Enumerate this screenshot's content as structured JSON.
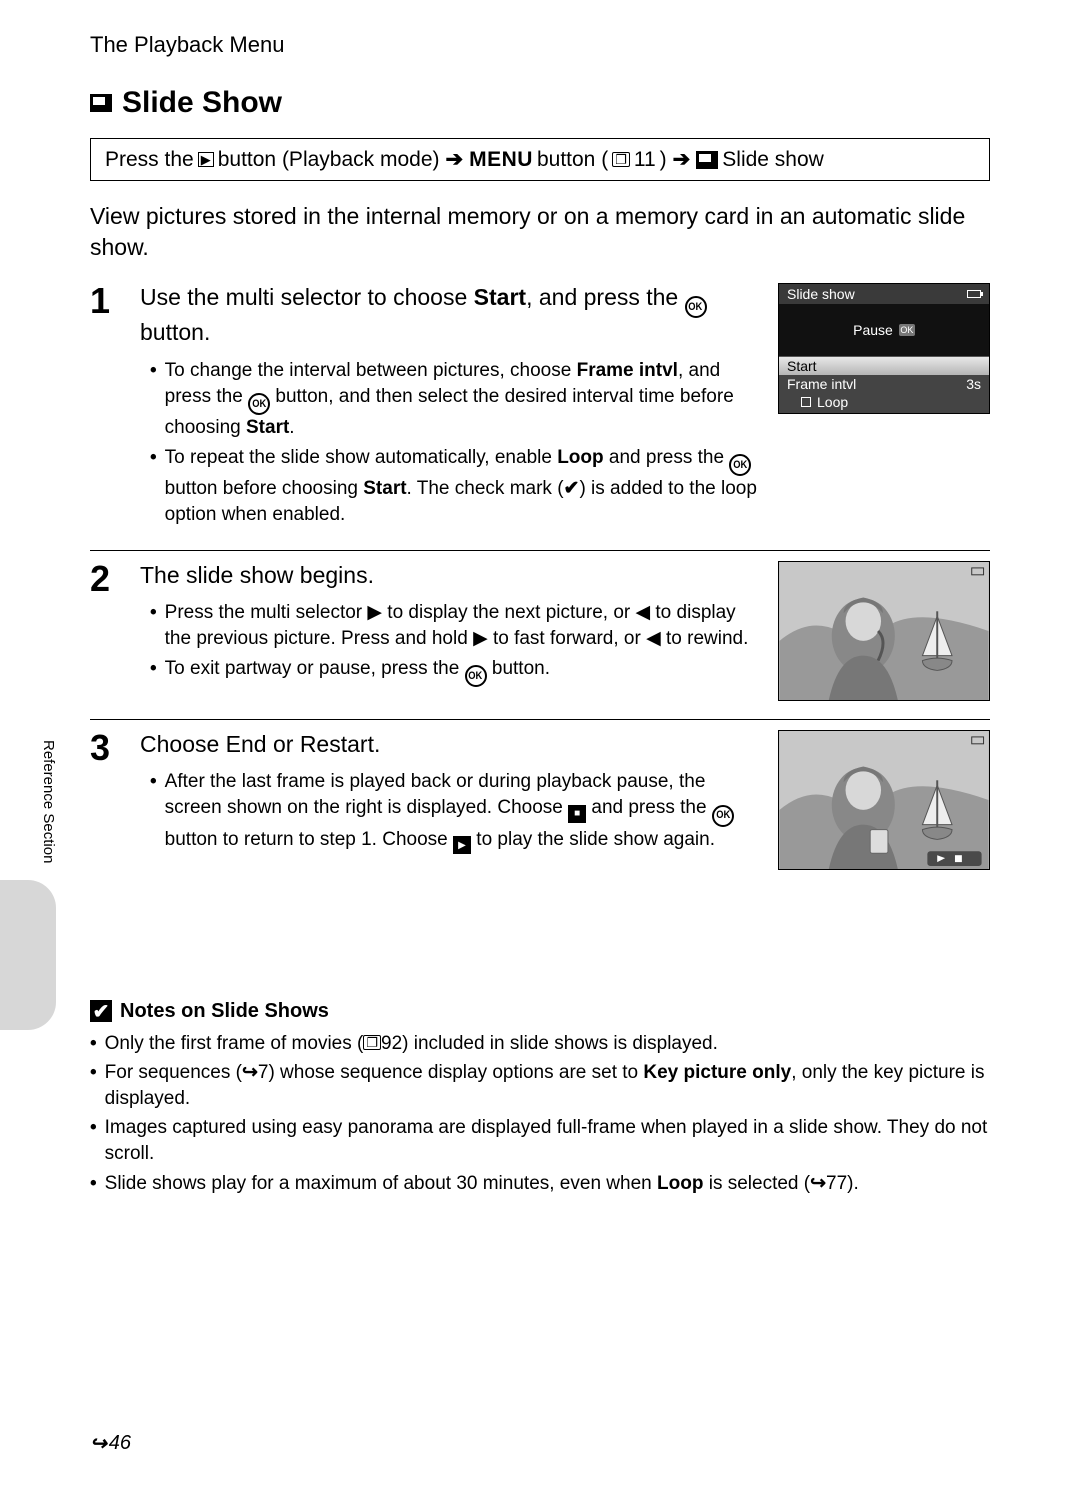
{
  "header": "The Playback Menu",
  "title": "Slide Show",
  "nav": {
    "p1": "Press the",
    "p2": " button (Playback mode)",
    "menu": "MENU",
    "p3": " button (",
    "ref11": "11",
    "p4": ")",
    "p5": " Slide show"
  },
  "intro": "View pictures stored in the internal memory or on a memory card in an automatic slide show.",
  "steps": {
    "s1": {
      "num": "1",
      "title_a": "Use the multi selector to choose ",
      "title_b": "Start",
      "title_c": ", and press the ",
      "title_d": " button.",
      "bul1_a": "To change the interval between pictures, choose ",
      "bul1_b": "Frame intvl",
      "bul1_c": ", and press the ",
      "bul1_d": " button, and then select the desired interval time before choosing ",
      "bul1_e": "Start",
      "bul1_f": ".",
      "bul2_a": "To repeat the slide show automatically, enable ",
      "bul2_b": "Loop",
      "bul2_c": " and press the ",
      "bul2_d": " button before choosing ",
      "bul2_e": "Start",
      "bul2_f": ". The check mark (",
      "bul2_g": ") is added to the loop option when enabled."
    },
    "s2": {
      "num": "2",
      "title": "The slide show begins.",
      "bul1_a": "Press the multi selector ",
      "bul1_b": " to display the next picture, or ",
      "bul1_c": " to display the previous picture. Press and hold ",
      "bul1_d": " to fast forward, or ",
      "bul1_e": " to rewind.",
      "bul2_a": "To exit partway or pause, press the ",
      "bul2_b": " button."
    },
    "s3": {
      "num": "3",
      "title": "Choose End or Restart.",
      "bul1_a": "After the last frame is played back or during playback pause, the screen shown on the right is displayed. Choose ",
      "bul1_b": " and press the ",
      "bul1_c": " button to return to step 1. Choose ",
      "bul1_d": " to play the slide show again."
    }
  },
  "lcd": {
    "title": "Slide show",
    "pause": "Pause",
    "start": "Start",
    "frame": "Frame intvl",
    "time": "3s",
    "loop": "Loop"
  },
  "notes": {
    "title": "Notes on Slide Shows",
    "n1_a": "Only the first frame of movies (",
    "n1_b": "92) included in slide shows is displayed.",
    "n2_a": "For sequences (",
    "n2_b": "7) whose sequence display options are set to ",
    "n2_c": "Key picture only",
    "n2_d": ", only the key picture is displayed.",
    "n3": "Images captured using easy panorama are displayed full-frame when played in a slide show. They do not scroll.",
    "n4_a": "Slide shows play for a maximum of about 30 minutes, even when ",
    "n4_b": "Loop",
    "n4_c": " is selected (",
    "n4_d": "77)."
  },
  "side_label": "Reference Section",
  "page_num": "46"
}
